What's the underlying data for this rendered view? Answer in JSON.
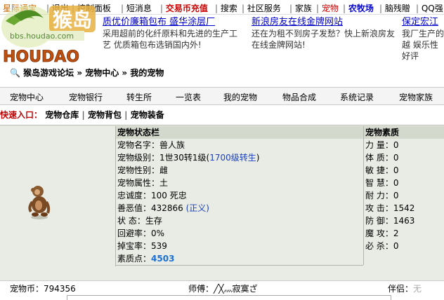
{
  "topnav": {
    "items": [
      {
        "label": "星际通宝",
        "color": "#cc6600"
      },
      {
        "label": "退出",
        "color": "#000000"
      },
      {
        "label": "控制面板",
        "color": "#000000"
      },
      {
        "label": "短消息",
        "color": "#000000"
      },
      {
        "label": "交易币充值",
        "color": "#cc0000"
      },
      {
        "label": "搜索",
        "color": "#000000"
      },
      {
        "label": "社区服务",
        "color": "#000000"
      },
      {
        "label": "家族",
        "color": "#000000"
      },
      {
        "label": "宠物",
        "color": "#cc0000"
      },
      {
        "label": "农牧场",
        "color": "#0000cc"
      },
      {
        "label": "脑残贈",
        "color": "#000000"
      },
      {
        "label": "QQ强",
        "color": "#000000"
      }
    ]
  },
  "logo": {
    "text": "HOUDAO",
    "cn": "猴岛",
    "url": "bbs.houdao.com"
  },
  "ads": [
    {
      "head": "质优价廉箱包布 盛华涂层厂",
      "body": "采用超前的化纤原料和先进的生产工艺 优质箱包布选销国内外!"
    },
    {
      "head": "新浪房友在线金牌网站",
      "body": "还在为租不到房子发愁？快上新浪房友在线金牌网站!"
    },
    {
      "head": "保定宏江",
      "body": "我厂生产的越 娱乐性好评"
    }
  ],
  "breadcrumb": {
    "icon": "search-icon",
    "text": "猴岛游戏论坛 » 宠物中心 » 我的宠物"
  },
  "menu": [
    "宠物中心",
    "宠物银行",
    "转生所",
    "一览表",
    "我的宠物",
    "物品合成",
    "系统记录",
    "宠物家族"
  ],
  "quick": {
    "label": "快速入口：",
    "links": [
      "宠物仓库",
      "宠物背包",
      "宠物装备"
    ]
  },
  "status": {
    "title": "宠物状态栏",
    "name": "宠物名字：兽人族",
    "level_prefix": "宠物级别：1世30转1级(",
    "level_link": "1700级转生",
    "level_suffix": ")",
    "gender": "宠物性别：雌",
    "attribute": "宠物属性：土",
    "loyalty": "忠诚度：100 死忠",
    "karma_prefix": "善恶值：432866 ",
    "karma_link": "(正义)",
    "state": "状   态：生存",
    "dodge": "回避率：0%",
    "drop": "掉宝率：539",
    "quality_prefix": "素质点：",
    "quality_value": "4503"
  },
  "quality": {
    "title": "宠物素质",
    "rows": [
      {
        "label": "力   量：",
        "value": "0"
      },
      {
        "label": "体   质：",
        "value": "0"
      },
      {
        "label": "敏   捷：",
        "value": "0"
      },
      {
        "label": "智   慧：",
        "value": "0"
      },
      {
        "label": "耐   力：",
        "value": "0"
      },
      {
        "label": "攻   击：",
        "value": "1542"
      },
      {
        "label": "防   御：",
        "value": "1463"
      },
      {
        "label": "魔   攻：",
        "value": "2"
      },
      {
        "label": "必   杀：",
        "value": "0"
      }
    ]
  },
  "bottom": {
    "coin": "宠物币：794356",
    "master_label": "师傅：",
    "master_value": "╱╳灬寂寞ざ",
    "partner_label": "伴侣：",
    "partner_value": "无"
  }
}
